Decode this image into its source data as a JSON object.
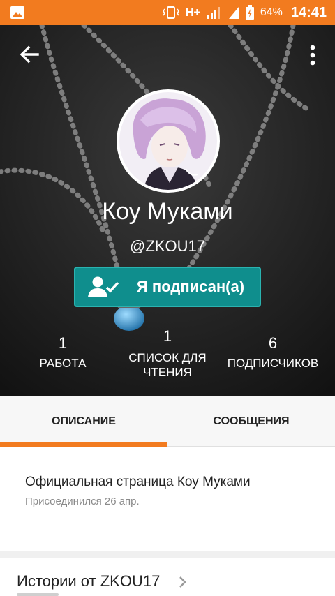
{
  "status_bar": {
    "network": "H+",
    "battery": "64%",
    "time": "14:41"
  },
  "profile": {
    "display_name": "Коу Муками",
    "username": "@ZKOU17",
    "follow_button_label": "Я подписан(а)"
  },
  "stats": [
    {
      "value": "1",
      "label": "РАБОТА"
    },
    {
      "value": "1",
      "label": "СПИСОК ДЛЯ\nЧТЕНИЯ"
    },
    {
      "value": "6",
      "label": "ПОДПИСЧИКОВ"
    }
  ],
  "tabs": [
    {
      "label": "ОПИСАНИЕ",
      "active": true
    },
    {
      "label": "СООБЩЕНИЯ",
      "active": false
    }
  ],
  "about": {
    "description": "Официальная страница Коу Муками",
    "joined": "Присоединился 26 апр."
  },
  "stories": {
    "title": "Истории от ZKOU17"
  },
  "colors": {
    "accent": "#f27b1f",
    "follow_button": "#0f8e8d"
  },
  "icons": {
    "status_left": "gallery-icon",
    "back": "arrow-left-icon",
    "more": "more-vertical-icon",
    "follow": "person-check-icon",
    "stories": "chevron-right-icon"
  }
}
